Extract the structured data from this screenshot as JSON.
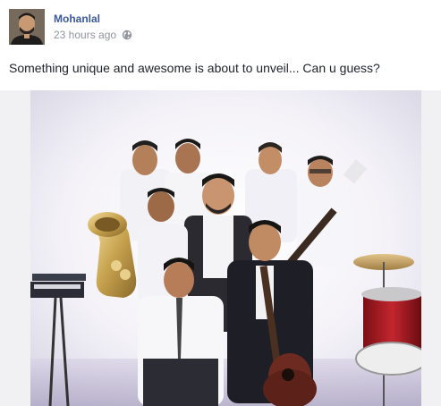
{
  "post": {
    "author": "Mohanlal",
    "timestamp": "23 hours ago",
    "privacy_icon": "globe-icon",
    "message": "Something unique and awesome is about to unveil... Can u guess?"
  },
  "media": {
    "kind": "photo",
    "description_icon": "band-group-photo"
  },
  "colors": {
    "author_link": "#3b5998",
    "meta_text": "#90949c",
    "body_text": "#1d2129",
    "media_background": "#f1f1f3"
  }
}
